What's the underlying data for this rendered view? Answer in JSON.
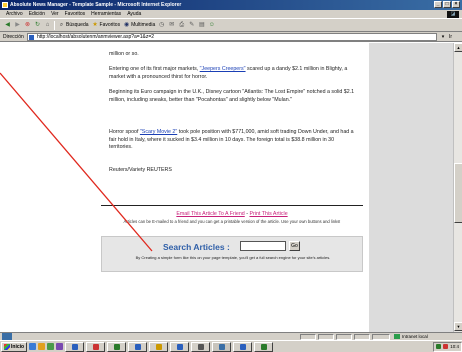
{
  "window": {
    "title": "Absolute News Manager - Template Sample - Microsoft Internet Explorer",
    "controls": [
      "_",
      "□",
      "×"
    ]
  },
  "menu": [
    "Archivo",
    "Edición",
    "Ver",
    "Favoritos",
    "Herramientas",
    "Ayuda"
  ],
  "toolbar": {
    "back": "Atrás",
    "search": "Búsqueda",
    "favorites": "Favoritos",
    "media": "Multimedia"
  },
  "address": {
    "label": "Dirección",
    "url": "http://localhost/absolutenm/anmviewer.asp?a=1&z=2",
    "go": "Ir"
  },
  "article": {
    "p0": "million or so.",
    "p1_before": "Entering one of its first major markets, ",
    "p1_link": "\"Jeepers Creepers\"",
    "p1_after": " scared up a dandy $2.1 million in Blighty, a market with a pronounced thirst for horror.",
    "p2": "Beginning its Euro campaign in the U.K., Disney cartoon \"Atlantis: The Lost Empire\" notched a solid $2.1 million, including sneaks, better than \"Pocahontas\" and slightly below \"Mulan.\"",
    "p3_before": "Horror spoof ",
    "p3_link": "\"Scary Movie 2\"",
    "p3_after": " took pole position with $771,000, amid soft trading Down Under, and had a fair hold in Italy, where it sucked in $3.4 million in 10 days. The foreign total is $38.8 million in 30 territories.",
    "byline": "Reuters/Variety REUTERS"
  },
  "actions": {
    "email_link": "Email This Article To A Friend",
    "separator": " - ",
    "print_link": "Print This Article",
    "description": "Articles can be E-mailed to a friend and you can get a printable version of the article. Use your own buttons and links!"
  },
  "search": {
    "label": "Search Articles :",
    "button": "Go",
    "note": "By Creating a simple form like this on your page template, you'll get a full search engine for your site's articles."
  },
  "status": {
    "zone": "Intranet local"
  },
  "taskbar": {
    "start": "Inicio",
    "clock": "10:4"
  },
  "colors": {
    "link_blue": "#1a3fb5",
    "link_magenta": "#c8207a",
    "search_blue": "#2f5fa8",
    "annotation_red": "#e0281e"
  }
}
